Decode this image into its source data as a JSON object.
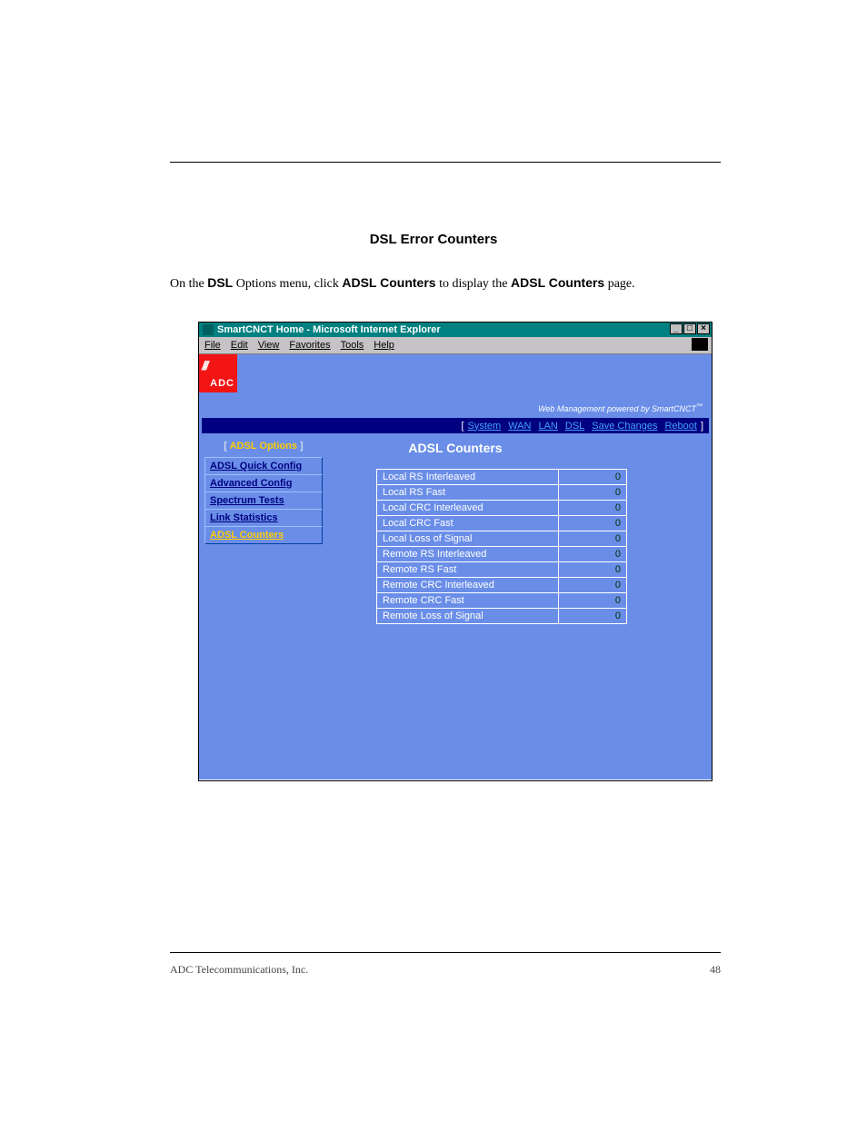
{
  "heading_error_counters": "DSL Error Counters",
  "desc": {
    "prefix": "On the ",
    "b1": "DSL",
    "middle1": " Options menu, click ",
    "b2": "ADSL Counters",
    "middle2": " to display the ",
    "b3": "ADSL Counters",
    "suffix": " page."
  },
  "footer_left": "ADC Telecommunications, Inc.",
  "footer_right": "48",
  "window": {
    "title": "SmartCNCT Home - Microsoft Internet Explorer",
    "menus": [
      "File",
      "Edit",
      "View",
      "Favorites",
      "Tools",
      "Help"
    ],
    "winbtns": {
      "min": "_",
      "max": "□",
      "close": "×"
    }
  },
  "logo": {
    "slashes": "///",
    "text": "ADC"
  },
  "brand_line": "Web Management powered by SmartCNCT",
  "topnav": {
    "open": "[ ",
    "close": " ]",
    "items": [
      "System",
      "WAN",
      "LAN",
      "DSL",
      "Save Changes",
      "Reboot"
    ]
  },
  "sidebar": {
    "title_open": "[ ",
    "title": "ADSL Options",
    "title_close": " ]",
    "items": [
      {
        "label": "ADSL Quick Config",
        "active": false
      },
      {
        "label": "Advanced Config",
        "active": false
      },
      {
        "label": "Spectrum Tests",
        "active": false
      },
      {
        "label": "Link Statistics",
        "active": false
      },
      {
        "label": "ADSL Counters",
        "active": true
      }
    ]
  },
  "content_title": "ADSL Counters",
  "counters": [
    {
      "label": "Local RS Interleaved",
      "value": "0"
    },
    {
      "label": "Local RS Fast",
      "value": "0"
    },
    {
      "label": "Local CRC Interleaved",
      "value": "0"
    },
    {
      "label": "Local CRC Fast",
      "value": "0"
    },
    {
      "label": "Local Loss of Signal",
      "value": "0"
    },
    {
      "label": "Remote RS Interleaved",
      "value": "0"
    },
    {
      "label": "Remote RS Fast",
      "value": "0"
    },
    {
      "label": "Remote CRC Interleaved",
      "value": "0"
    },
    {
      "label": "Remote CRC Fast",
      "value": "0"
    },
    {
      "label": "Remote Loss of Signal",
      "value": "0"
    }
  ]
}
